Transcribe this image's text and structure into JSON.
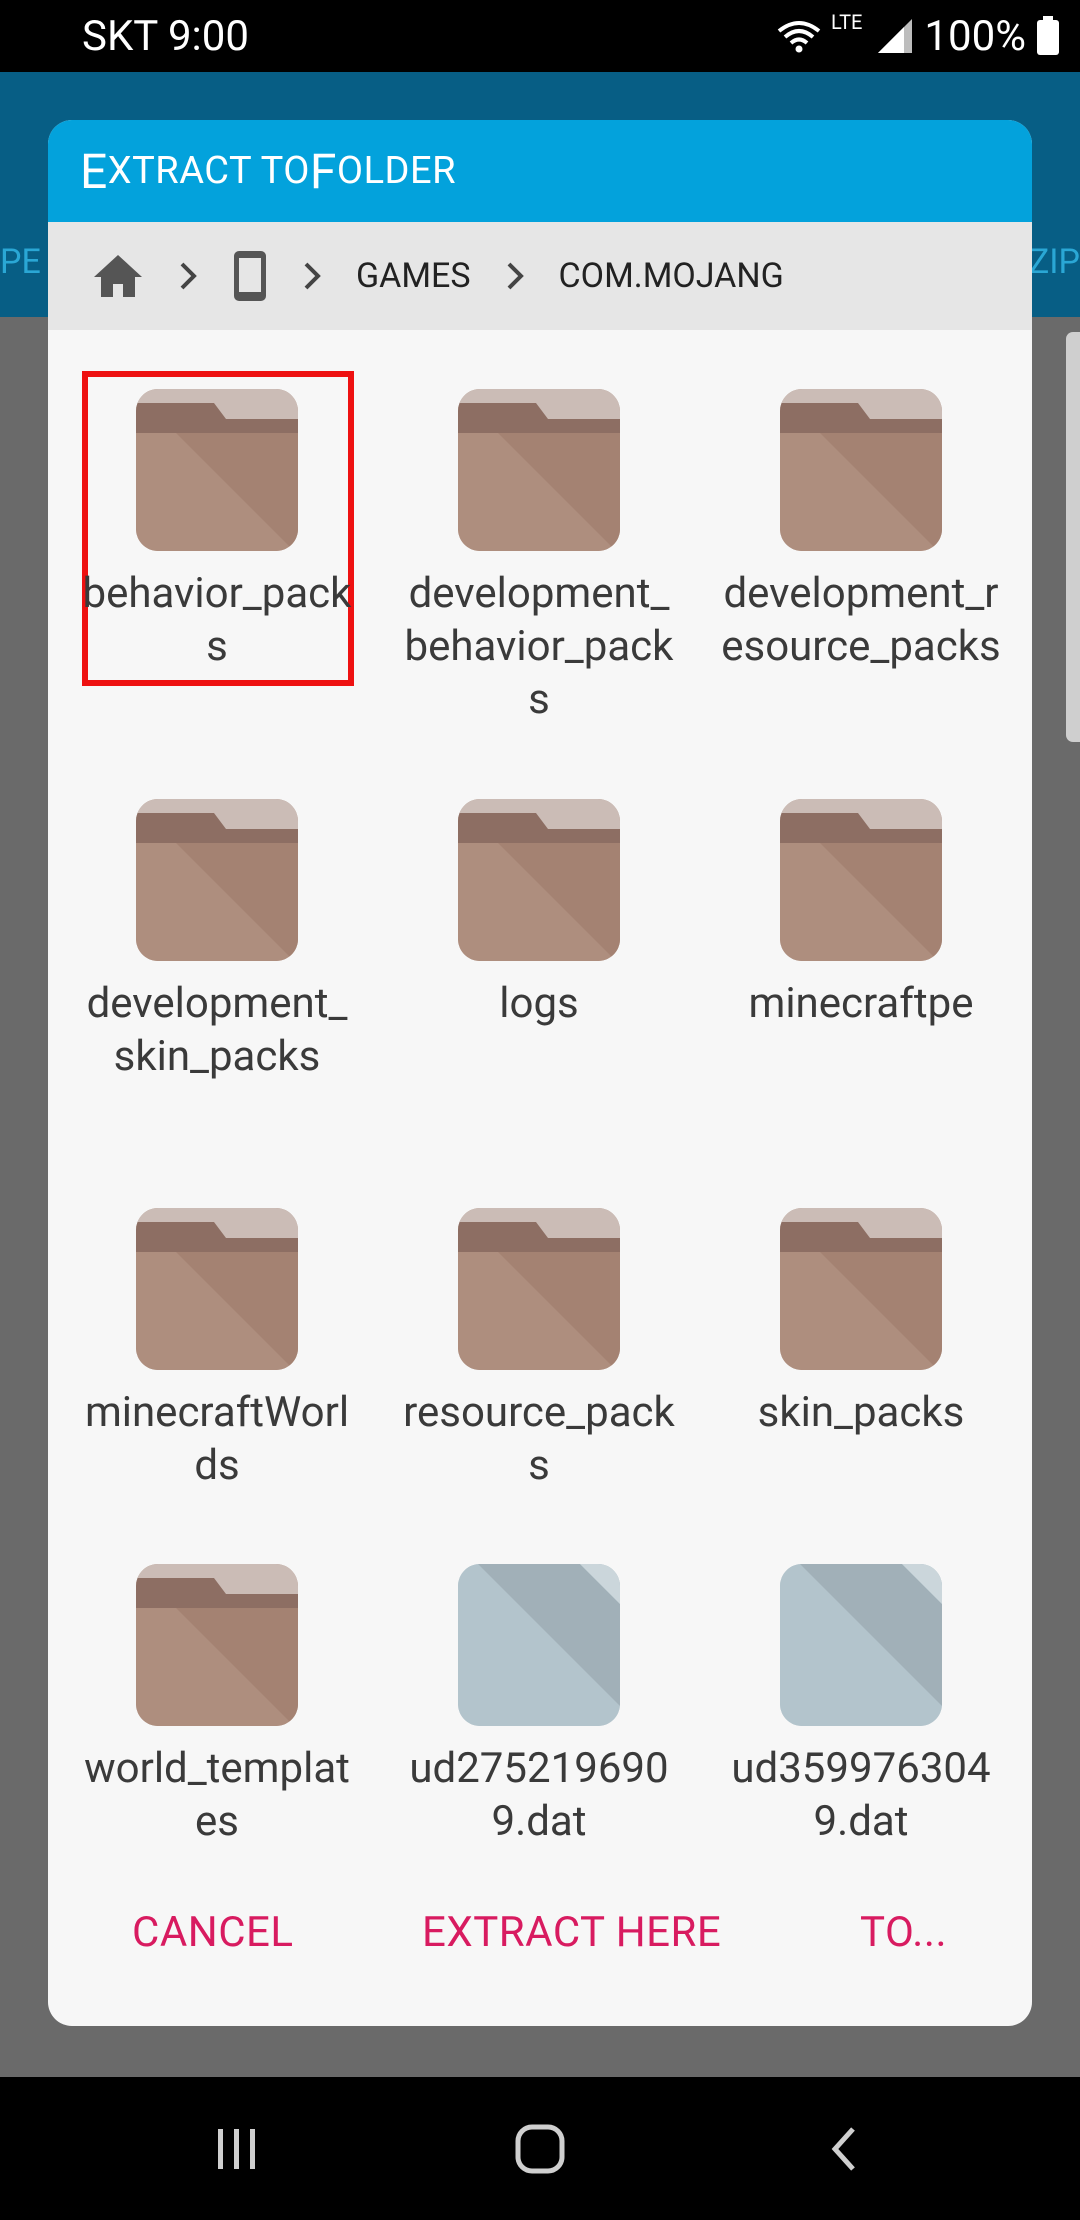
{
  "status_bar": {
    "carrier_time": "SKT 9:00",
    "network": "LTE",
    "battery": "100%"
  },
  "background_app": {
    "tab_left_fragment": "PE",
    "tab_right_fragment": "ZIP"
  },
  "dialog": {
    "title_first": "E",
    "title_first_rest": "XTRACT TO ",
    "title_second": "F",
    "title_second_rest": "OLDER",
    "breadcrumb": {
      "home_icon": "home-icon",
      "device_icon": "phone-icon",
      "segments": [
        "GAMES",
        "COM.MOJANG"
      ]
    },
    "items": [
      {
        "name": "behavior_packs",
        "type": "folder",
        "selected": true
      },
      {
        "name": "development_behavior_packs",
        "type": "folder"
      },
      {
        "name": "development_resource_packs",
        "type": "folder"
      },
      {
        "name": "development_skin_packs",
        "type": "folder"
      },
      {
        "name": "logs",
        "type": "folder"
      },
      {
        "name": "minecraftpe",
        "type": "folder"
      },
      {
        "name": "minecraftWorlds",
        "type": "folder"
      },
      {
        "name": "resource_packs",
        "type": "folder"
      },
      {
        "name": "skin_packs",
        "type": "folder"
      },
      {
        "name": "world_templates",
        "type": "folder"
      },
      {
        "name": "ud2752196909.dat",
        "type": "file"
      },
      {
        "name": "ud3599763049.dat",
        "type": "file"
      }
    ],
    "actions": {
      "cancel": "CANCEL",
      "extract_here": "EXTRACT HERE",
      "to": "TO..."
    },
    "colors": {
      "title_bar": "#03a2dc",
      "action_text": "#d81b60",
      "folder": "#ae8e7e",
      "file": "#b3c4cc",
      "selection": "#ee1111"
    }
  }
}
